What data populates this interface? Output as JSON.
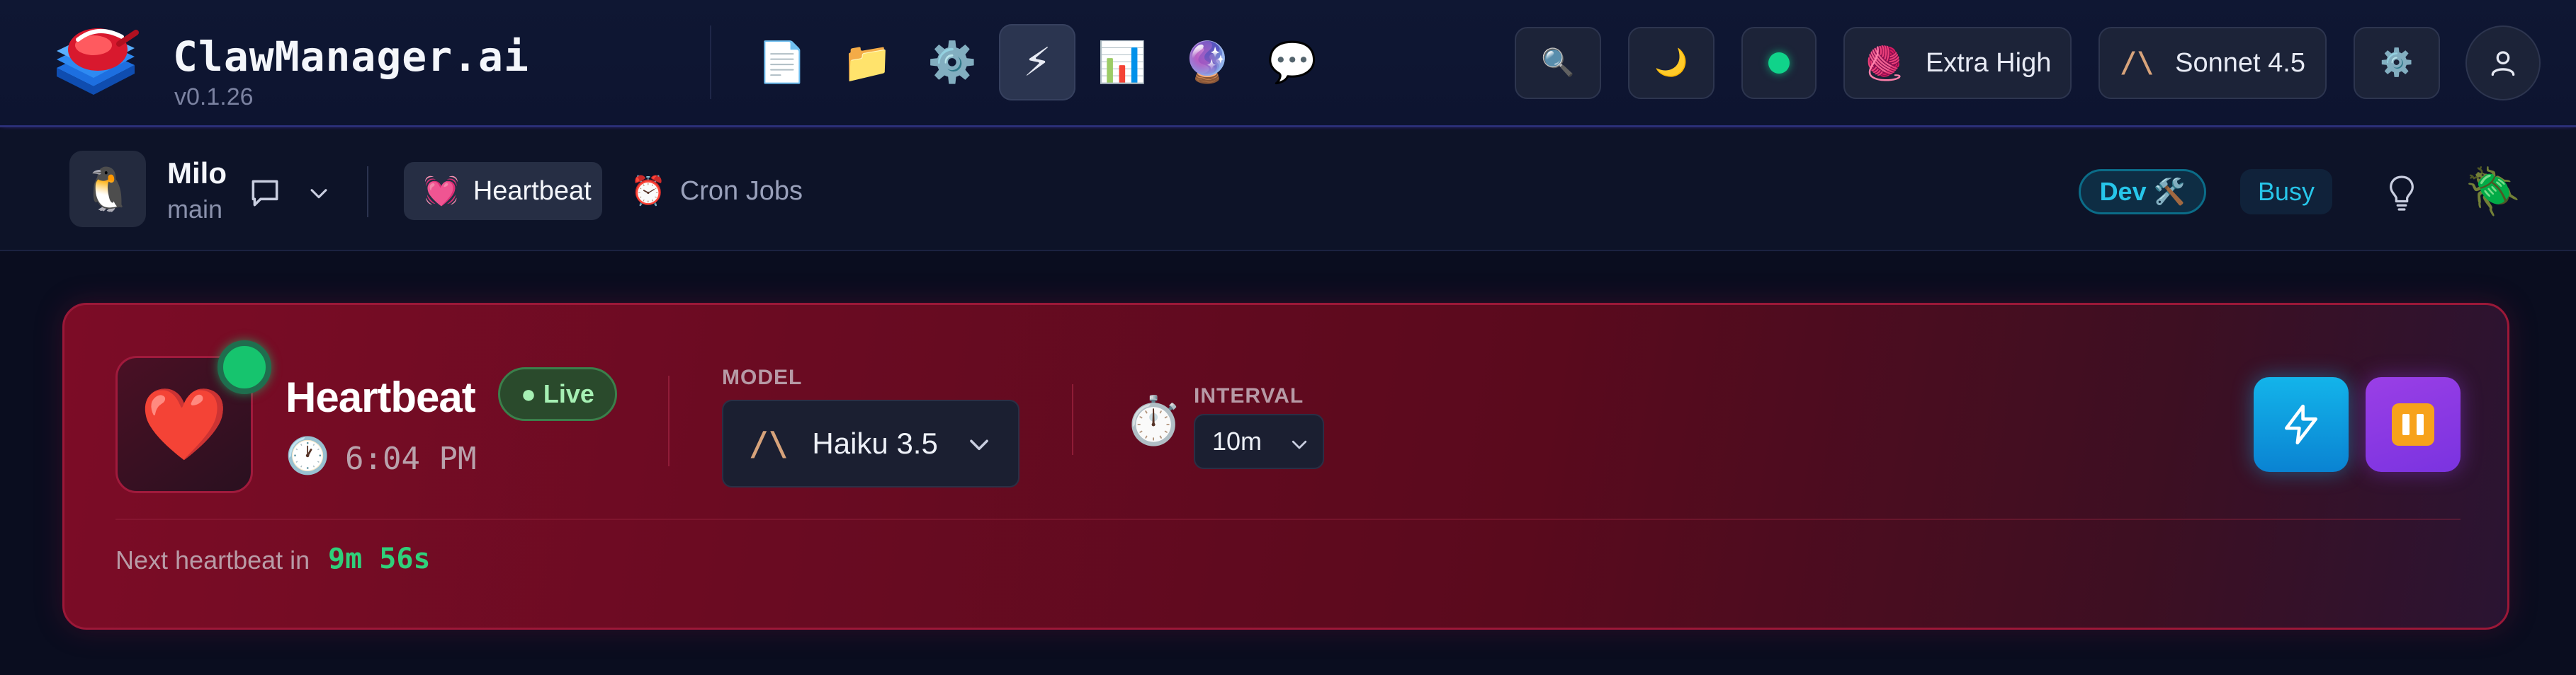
{
  "app": {
    "title": "ClawManager.ai",
    "version": "v0.1.26"
  },
  "nav": [
    {
      "name": "document",
      "glyph": "📄"
    },
    {
      "name": "folder",
      "glyph": "📁"
    },
    {
      "name": "settings-gear",
      "glyph": "⚙️"
    },
    {
      "name": "lightning",
      "glyph": "⚡",
      "active": true
    },
    {
      "name": "bar-chart",
      "glyph": "📊"
    },
    {
      "name": "crystal-ball",
      "glyph": "🔮"
    },
    {
      "name": "speech-bubble",
      "glyph": "💬"
    }
  ],
  "toolbar": {
    "search_glyph": "🔍",
    "theme_glyph": "🌙",
    "effort_glyph": "🧶",
    "effort_label": "Extra High",
    "model_glyph": "/\\",
    "model_label": "Sonnet 4.5",
    "settings_glyph": "⚙️",
    "status_color": "#10d38a"
  },
  "agent": {
    "avatar_glyph": "🐧",
    "name": "Milo",
    "branch": "main"
  },
  "tabs": [
    {
      "label": "Heartbeat",
      "glyph": "💓",
      "active": true
    },
    {
      "label": "Cron Jobs",
      "glyph": "⏰",
      "active": false
    }
  ],
  "badges": {
    "dev": "Dev 🛠️",
    "busy": "Busy",
    "bug_glyph": "🪲"
  },
  "heartbeat": {
    "icon_glyph": "❤️",
    "title": "Heartbeat",
    "live_label": "● Live",
    "clock_glyph": "🕐",
    "time": "6:04 PM",
    "model_label": "MODEL",
    "model_logo": "/\\",
    "model_value": "Haiku 3.5",
    "interval_glyph": "⏱️",
    "interval_label": "INTERVAL",
    "interval_value": "10m",
    "next_label": "Next heartbeat in",
    "next_value": "9m 56s"
  },
  "colors": {
    "accent_cyan": "#27c6ea",
    "live_green": "#16c46e",
    "card_red": "#7c0c26",
    "run_blue": "#13b4ea",
    "pause_purple": "#8a3be4"
  }
}
